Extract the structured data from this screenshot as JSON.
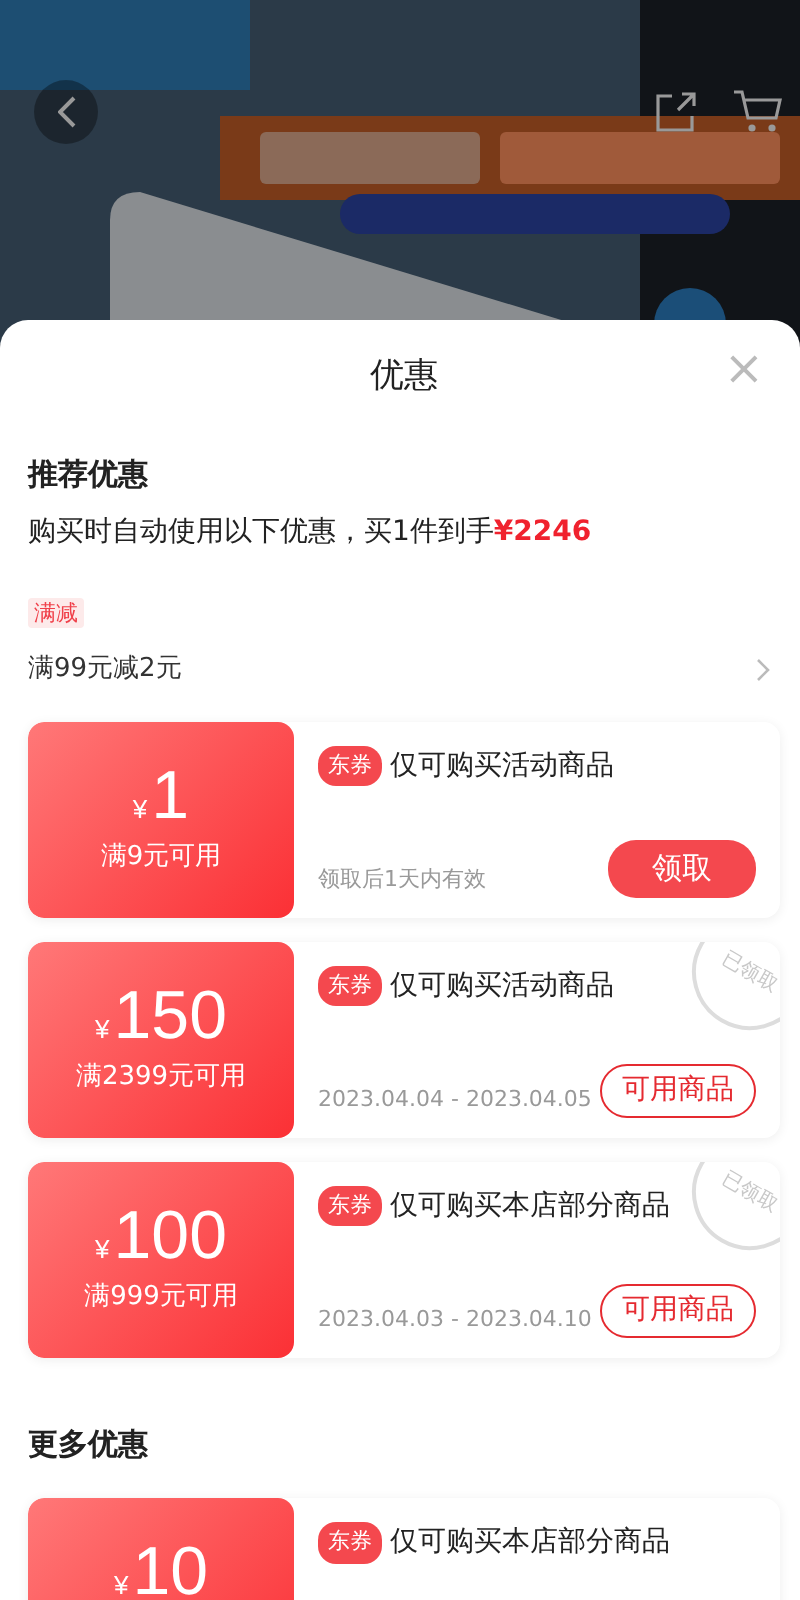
{
  "sheet": {
    "title": "优惠",
    "close": "×"
  },
  "recommended": {
    "heading": "推荐优惠",
    "summary": "购买时自动使用以下优惠，买1件到手",
    "price": "¥2246",
    "promo_tag": "满减",
    "promo_text": "满99元减2元"
  },
  "coupons": [
    {
      "currency": "¥",
      "amount": "1",
      "condition": "满9元可用",
      "tag": "东券",
      "title": "仅可购买活动商品",
      "validity": "领取后1天内有效",
      "button": "领取",
      "kind": "claim",
      "claimed": false
    },
    {
      "currency": "¥",
      "amount": "150",
      "condition": "满2399元可用",
      "tag": "东券",
      "title": "仅可购买活动商品",
      "validity": "2023.04.04 - 2023.04.05",
      "button": "可用商品",
      "kind": "view",
      "claimed": true,
      "stamp": "已领取"
    },
    {
      "currency": "¥",
      "amount": "100",
      "condition": "满999元可用",
      "tag": "东券",
      "title": "仅可购买本店部分商品",
      "validity": "2023.04.03 - 2023.04.10",
      "button": "可用商品",
      "kind": "view",
      "claimed": true,
      "stamp": "已领取"
    }
  ],
  "more": {
    "heading": "更多优惠",
    "coupons": [
      {
        "currency": "¥",
        "amount": "10",
        "tag": "东券",
        "title": "仅可购买本店部分商品"
      }
    ]
  }
}
